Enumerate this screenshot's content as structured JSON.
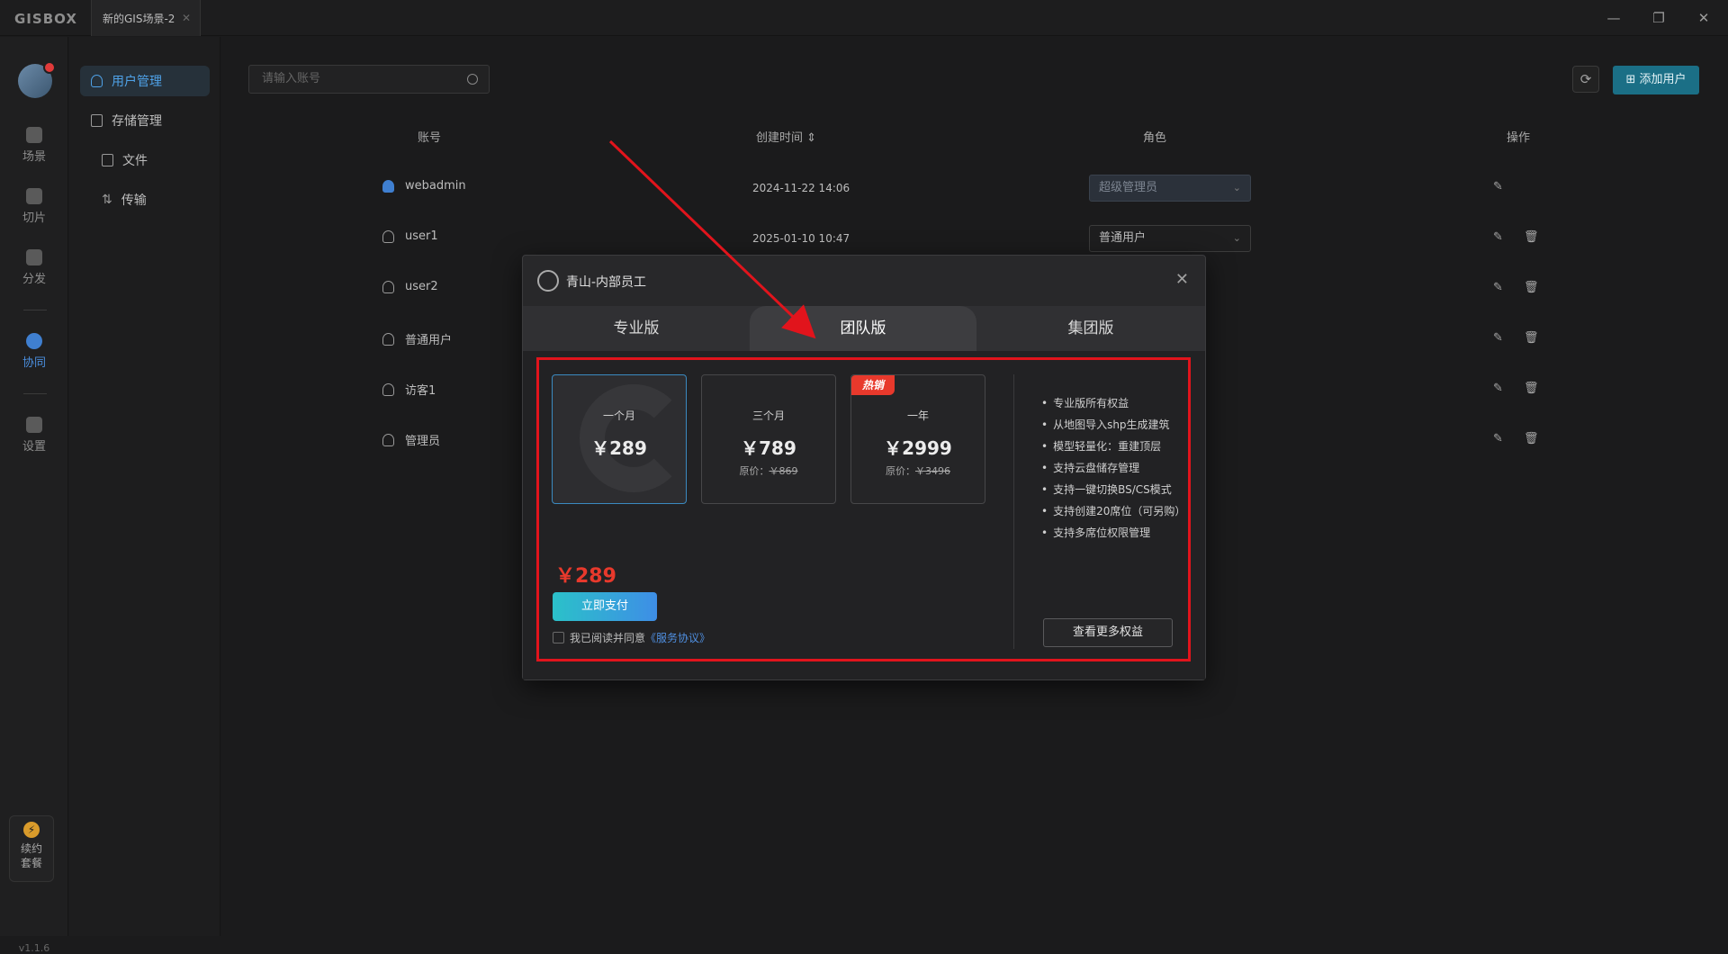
{
  "app": {
    "logo": "GISBOX",
    "tab_title": "新的GIS场景-2",
    "version": "v1.1.6"
  },
  "rail": {
    "items": [
      {
        "label": "场景",
        "icon": "home-icon"
      },
      {
        "label": "切片",
        "icon": "slice-icon"
      },
      {
        "label": "分发",
        "icon": "distribute-icon"
      },
      {
        "label": "协同",
        "icon": "lock-icon",
        "active": true
      },
      {
        "label": "设置",
        "icon": "gear-icon"
      }
    ],
    "renew": {
      "line1": "续约",
      "line2": "套餐"
    }
  },
  "subnav": {
    "items": [
      {
        "label": "用户管理",
        "active": true
      },
      {
        "label": "存储管理"
      },
      {
        "label": "文件"
      },
      {
        "label": "传输"
      }
    ]
  },
  "toolbar": {
    "search_placeholder": "请输入账号",
    "add_user_label": "添加用户"
  },
  "table": {
    "headers": {
      "account": "账号",
      "created": "创建时间",
      "role": "角色",
      "ops": "操作"
    },
    "rows": [
      {
        "account": "webadmin",
        "created": "2024-11-22 14:06",
        "role": "超级管理员"
      },
      {
        "account": "user1",
        "created": "2025-01-10 10:47",
        "role": "普通用户"
      },
      {
        "account": "user2",
        "created": "",
        "role": ""
      },
      {
        "account": "普通用户",
        "created": "",
        "role": ""
      },
      {
        "account": "访客1",
        "created": "",
        "role": ""
      },
      {
        "account": "管理员",
        "created": "",
        "role": ""
      }
    ]
  },
  "modal": {
    "title": "青山-内部员工",
    "tabs": [
      "专业版",
      "团队版",
      "集团版"
    ],
    "active_tab": "团队版",
    "plans": [
      {
        "name": "一个月",
        "price": "￥289",
        "original_label": "",
        "original": ""
      },
      {
        "name": "三个月",
        "price": "￥789",
        "original_label": "原价：",
        "original": "￥869"
      },
      {
        "name": "一年",
        "price": "￥2999",
        "original_label": "原价：",
        "original": "￥3496",
        "badge": "热销"
      }
    ],
    "selected_total": "￥289",
    "pay_label": "立即支付",
    "agree_text": "我已阅读并同意",
    "agree_link": "《服务协议》",
    "benefits": [
      "专业版所有权益",
      "从地图导入shp生成建筑",
      "模型轻量化：重建顶层",
      "支持云盘储存管理",
      "支持一键切换BS/CS模式",
      "支持创建20席位（可另购）",
      "支持多席位权限管理"
    ],
    "more_label": "查看更多权益"
  },
  "colors": {
    "accent": "#1b6f86",
    "highlight_box": "#e1141c",
    "price_red": "#e8392c"
  }
}
